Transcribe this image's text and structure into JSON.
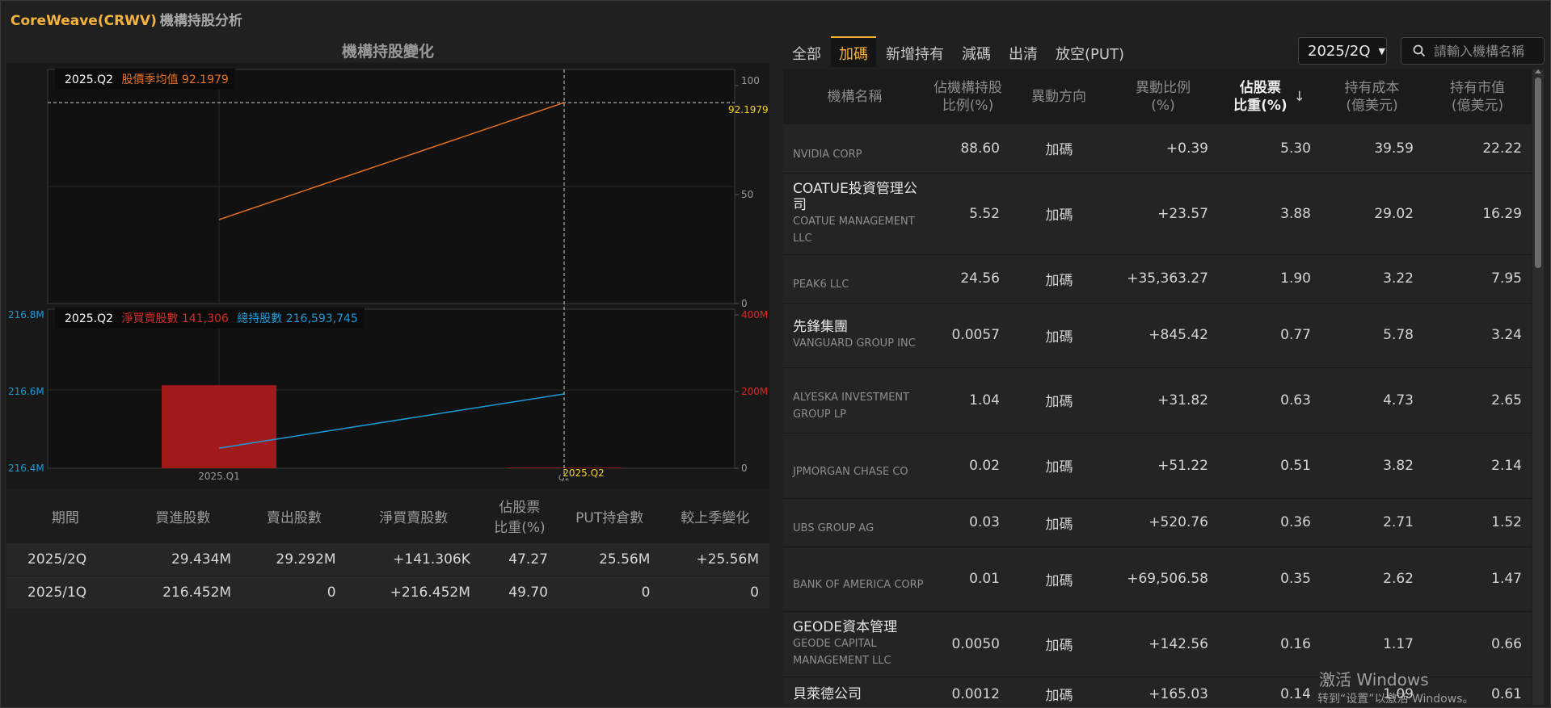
{
  "app": {
    "title": "CoreWeave(CRWV)",
    "subtitle": "機構持股分析"
  },
  "chart_title": "機構持股變化",
  "chart_data": [
    {
      "type": "line",
      "categories": [
        "2025.Q1",
        "2025.Q2"
      ],
      "series": [
        {
          "name": "股價季均值",
          "values": [
            38.5,
            92.1979
          ],
          "color": "#e8711e"
        }
      ],
      "ylim": [
        0,
        100
      ],
      "y_ticks": [
        "100",
        "50",
        "0"
      ],
      "hover": {
        "period": "2025.Q2",
        "label": "股價季均值",
        "value": "92.1979",
        "marker_label": "92.1979"
      }
    },
    {
      "type": "bar",
      "categories": [
        "2025.Q1",
        "2025.Q2"
      ],
      "series": [
        {
          "name": "淨買賣股數",
          "type": "bar",
          "values": [
            216452000,
            141306
          ],
          "color": "#a11a1a"
        },
        {
          "name": "總持股數",
          "type": "line",
          "values": [
            216452439,
            216593745
          ],
          "color": "#1a9ad6"
        }
      ],
      "left_axis": {
        "ticks": [
          "216.8M",
          "216.6M",
          "216.4M"
        ],
        "range": [
          216400000,
          216800000
        ]
      },
      "right_axis": {
        "ticks": [
          "400M",
          "200M",
          "0"
        ],
        "range": [
          0,
          400000000
        ]
      },
      "x_ticks": [
        "2025.Q1",
        "Q2"
      ],
      "hover": {
        "period": "2025.Q2",
        "net_label": "淨買賣股數",
        "net_value": "141,306",
        "total_label": "總持股數",
        "total_value": "216,593,745",
        "x_label": "2025.Q2"
      }
    }
  ],
  "stats": {
    "headers": [
      "期間",
      "買進股數",
      "賣出股數",
      "淨買賣股數",
      "佔股票\n比重(%)",
      "PUT持倉數",
      "較上季變化"
    ],
    "rows": [
      [
        "2025/2Q",
        "29.434M",
        "29.292M",
        "+141.306K",
        "47.27",
        "25.56M",
        "+25.56M"
      ],
      [
        "2025/1Q",
        "216.452M",
        "0",
        "+216.452M",
        "49.70",
        "0",
        "0"
      ]
    ]
  },
  "tabs": [
    "全部",
    "加碼",
    "新增持有",
    "減碼",
    "出清",
    "放空(PUT)"
  ],
  "active_tab": 1,
  "period_select": "2025/2Q",
  "search": {
    "placeholder": "請輸入機構名稱"
  },
  "table": {
    "headers": [
      "機構名稱",
      "佔機構持股\n比例(%)",
      "異動方向",
      "異動比例\n(%)",
      "佔股票\n比重(%)",
      "持有成本\n(億美元)",
      "持有市值\n(億美元)"
    ],
    "sort_arrow": "↓",
    "rows": [
      {
        "cn": "",
        "en": "NVIDIA CORP",
        "pct": "88.60",
        "dir": "加碼",
        "chg": "+0.39",
        "weight": "5.30",
        "cost": "39.59",
        "value": "22.22"
      },
      {
        "cn": "COATUE投資管理公司",
        "en": "COATUE MANAGEMENT LLC",
        "pct": "5.52",
        "dir": "加碼",
        "chg": "+23.57",
        "weight": "3.88",
        "cost": "29.02",
        "value": "16.29"
      },
      {
        "cn": "",
        "en": "PEAK6 LLC",
        "pct": "24.56",
        "dir": "加碼",
        "chg": "+35,363.27",
        "weight": "1.90",
        "cost": "3.22",
        "value": "7.95"
      },
      {
        "cn": "先鋒集團",
        "en": "VANGUARD GROUP INC",
        "pct": "0.0057",
        "dir": "加碼",
        "chg": "+845.42",
        "weight": "0.77",
        "cost": "5.78",
        "value": "3.24"
      },
      {
        "cn": "",
        "en": "ALYESKA INVESTMENT GROUP LP",
        "pct": "1.04",
        "dir": "加碼",
        "chg": "+31.82",
        "weight": "0.63",
        "cost": "4.73",
        "value": "2.65"
      },
      {
        "cn": "",
        "en": "JPMORGAN CHASE CO",
        "pct": "0.02",
        "dir": "加碼",
        "chg": "+51.22",
        "weight": "0.51",
        "cost": "3.82",
        "value": "2.14"
      },
      {
        "cn": "",
        "en": "UBS GROUP AG",
        "pct": "0.03",
        "dir": "加碼",
        "chg": "+520.76",
        "weight": "0.36",
        "cost": "2.71",
        "value": "1.52"
      },
      {
        "cn": "",
        "en": "BANK OF AMERICA CORP",
        "pct": "0.01",
        "dir": "加碼",
        "chg": "+69,506.58",
        "weight": "0.35",
        "cost": "2.62",
        "value": "1.47"
      },
      {
        "cn": "GEODE資本管理",
        "en": "GEODE CAPITAL MANAGEMENT LLC",
        "pct": "0.0050",
        "dir": "加碼",
        "chg": "+142.56",
        "weight": "0.16",
        "cost": "1.17",
        "value": "0.66"
      },
      {
        "cn": "貝萊德公司",
        "en": "",
        "pct": "0.0012",
        "dir": "加碼",
        "chg": "+165.03",
        "weight": "0.14",
        "cost": "1.09",
        "value": "0.61"
      }
    ]
  },
  "watermark": {
    "line1": "激活 Windows",
    "line2": "转到“设置”以激活 Windows。"
  },
  "colors": {
    "accent": "#f3b33d",
    "price_line": "#e8711e",
    "net_bar": "#a11a1a",
    "total_line": "#1a9ad6"
  }
}
